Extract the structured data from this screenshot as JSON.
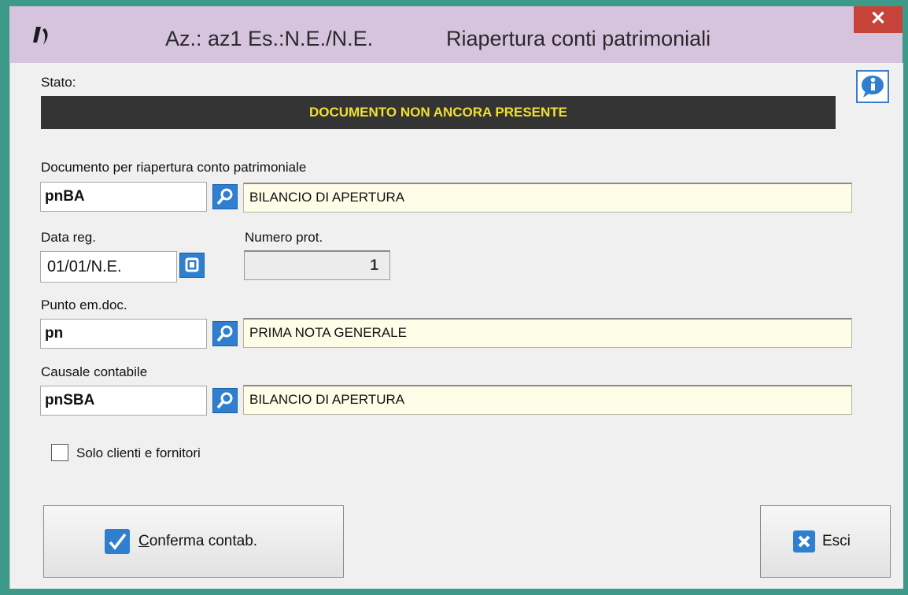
{
  "window": {
    "title_left": "Az.: az1 Es.:N.E./N.E.",
    "title_right": "Riapertura conti patrimoniali",
    "close_symbol": "✕"
  },
  "stato": {
    "label": "Stato:",
    "value": "DOCUMENTO NON ANCORA PRESENTE",
    "bar_color": "#343434",
    "text_color": "#f2e02c"
  },
  "documento": {
    "label": "Documento per riapertura conto patrimoniale",
    "code": "pnBA",
    "description": "BILANCIO DI APERTURA"
  },
  "data_reg": {
    "label": "Data reg.",
    "value": "01/01/N.E."
  },
  "numero_prot": {
    "label": "Numero prot.",
    "value": "1"
  },
  "punto_em": {
    "label": "Punto em.doc.",
    "code": "pn",
    "description": "PRIMA NOTA GENERALE"
  },
  "causale": {
    "label": "Causale contabile",
    "code": "pnSBA",
    "description": "BILANCIO DI APERTURA"
  },
  "solo_clienti": {
    "label": "Solo clienti e fornitori",
    "checked": false
  },
  "buttons": {
    "confirm_first": "C",
    "confirm_rest": "onferma contab.",
    "exit_label": "Esci"
  },
  "icons": {
    "app": "app-logo-icon",
    "info": "info-bubble-icon",
    "lookup": "search-icon",
    "calendar": "calendar-icon",
    "confirm": "checkmark-icon",
    "exit": "close-x-icon"
  },
  "colors": {
    "accent_blue": "#2f7fd0",
    "titlebar": "#d6c3de",
    "close_red": "#c7433a",
    "frame": "#3d9a8a"
  }
}
